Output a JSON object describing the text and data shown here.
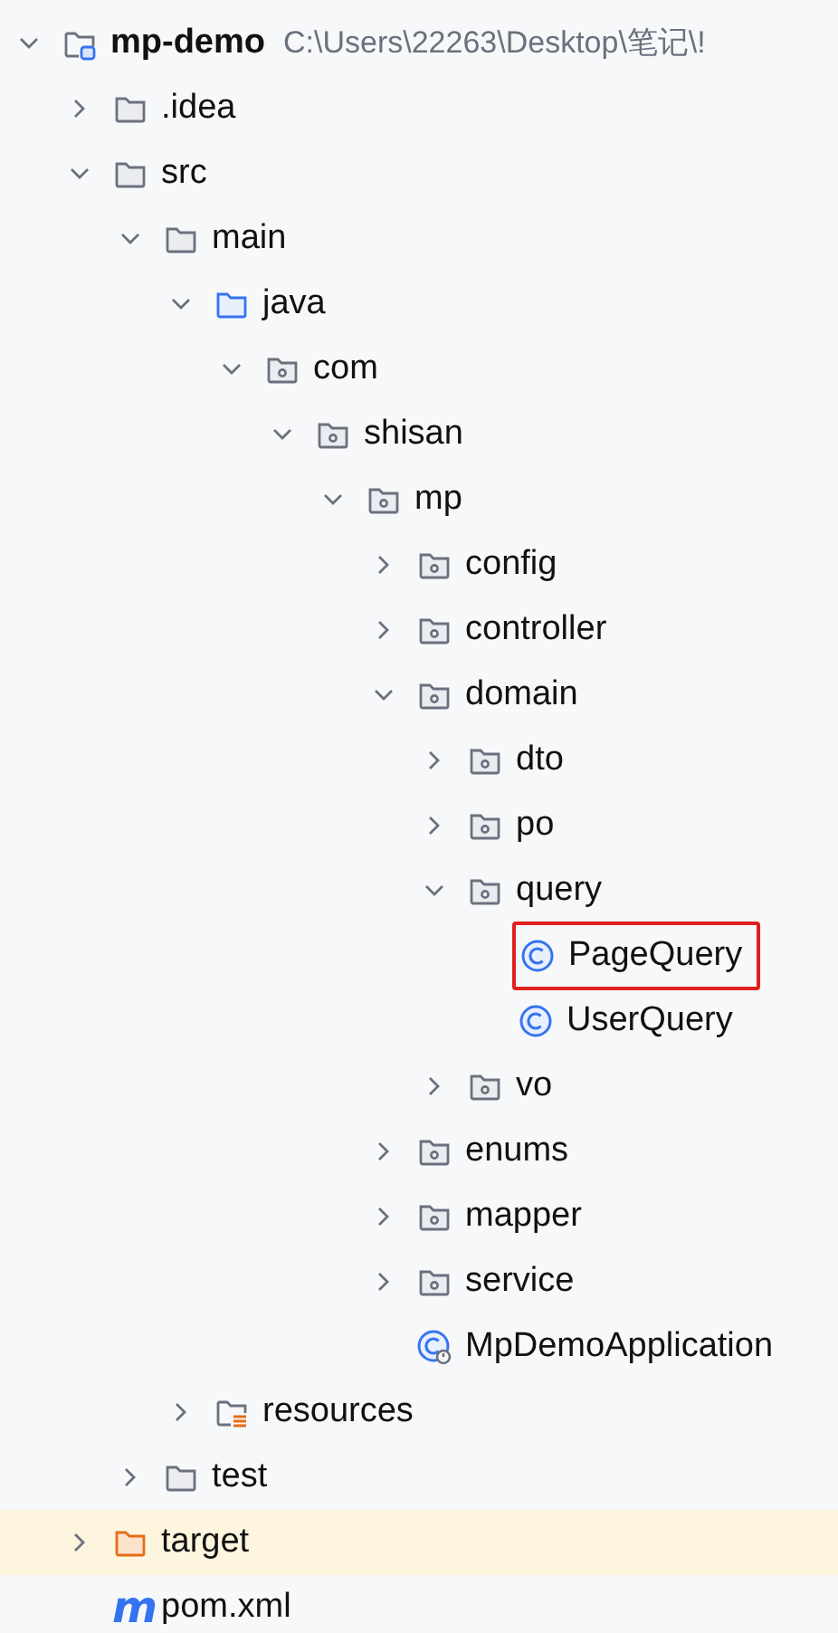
{
  "project_tree": [
    {
      "label": "mp-demo",
      "kind": "module",
      "expanded": true,
      "path": "C:\\Users\\22263\\Desktop\\笔记\\!",
      "children": [
        {
          "label": ".idea",
          "kind": "folder",
          "expanded": false
        },
        {
          "label": "src",
          "kind": "folder",
          "expanded": true,
          "children": [
            {
              "label": "main",
              "kind": "folder",
              "expanded": true,
              "children": [
                {
                  "label": "java",
                  "kind": "source-folder",
                  "expanded": true,
                  "children": [
                    {
                      "label": "com",
                      "kind": "package",
                      "expanded": true,
                      "children": [
                        {
                          "label": "shisan",
                          "kind": "package",
                          "expanded": true,
                          "children": [
                            {
                              "label": "mp",
                              "kind": "package",
                              "expanded": true,
                              "children": [
                                {
                                  "label": "config",
                                  "kind": "package",
                                  "expanded": false
                                },
                                {
                                  "label": "controller",
                                  "kind": "package",
                                  "expanded": false
                                },
                                {
                                  "label": "domain",
                                  "kind": "package",
                                  "expanded": true,
                                  "children": [
                                    {
                                      "label": "dto",
                                      "kind": "package",
                                      "expanded": false
                                    },
                                    {
                                      "label": "po",
                                      "kind": "package",
                                      "expanded": false
                                    },
                                    {
                                      "label": "query",
                                      "kind": "package",
                                      "expanded": true,
                                      "children": [
                                        {
                                          "label": "PageQuery",
                                          "kind": "class",
                                          "boxed": true
                                        },
                                        {
                                          "label": "UserQuery",
                                          "kind": "class",
                                          "boxed": false
                                        }
                                      ]
                                    },
                                    {
                                      "label": "vo",
                                      "kind": "package",
                                      "expanded": false
                                    }
                                  ]
                                },
                                {
                                  "label": "enums",
                                  "kind": "package",
                                  "expanded": false
                                },
                                {
                                  "label": "mapper",
                                  "kind": "package",
                                  "expanded": false
                                },
                                {
                                  "label": "service",
                                  "kind": "package",
                                  "expanded": false
                                },
                                {
                                  "label": "MpDemoApplication",
                                  "kind": "spring-class",
                                  "boxed": false
                                }
                              ]
                            }
                          ]
                        }
                      ]
                    }
                  ]
                },
                {
                  "label": "resources",
                  "kind": "resources-folder",
                  "expanded": false
                }
              ]
            },
            {
              "label": "test",
              "kind": "folder",
              "expanded": false
            }
          ]
        },
        {
          "label": "target",
          "kind": "excluded-folder",
          "expanded": false
        },
        {
          "label": "pom.xml",
          "kind": "maven",
          "glyph": "m"
        }
      ]
    }
  ]
}
